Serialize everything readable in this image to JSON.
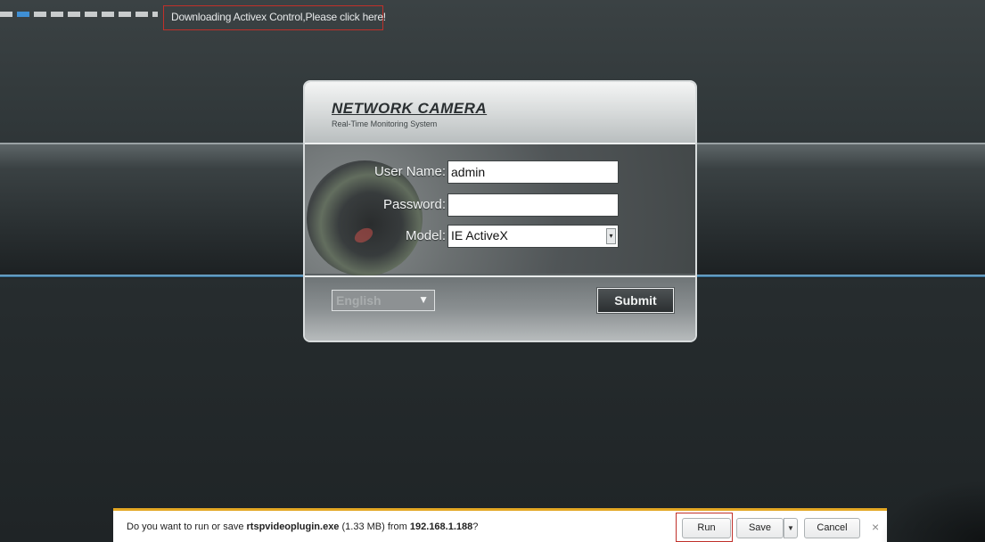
{
  "activex": {
    "notice": "Downloading Activex Control,Please click here!"
  },
  "login": {
    "brand_title": "NETWORK CAMERA",
    "brand_subtitle": "Real-Time Monitoring System",
    "username_label": "User Name:",
    "username_value": "admin",
    "password_label": "Password:",
    "password_value": "",
    "model_label": "Model:",
    "model_value": "IE ActiveX",
    "language_value": "English",
    "submit_label": "Submit"
  },
  "download_bar": {
    "message_prefix": "Do you want to run or save ",
    "file_name": "rtspvideoplugin.exe",
    "file_size": " (1.33 MB) from ",
    "host": "192.168.1.188",
    "message_suffix": "?",
    "run_label": "Run",
    "save_label": "Save",
    "cancel_label": "Cancel",
    "close_glyph": "×"
  },
  "icons": {
    "select_arrow": "▾",
    "language_arrow": "▼",
    "save_dropdown": "▼"
  },
  "colors": {
    "highlight_border": "#c0302a",
    "download_bar_accent": "#e3a724",
    "progress_active": "#3f8fd4"
  }
}
